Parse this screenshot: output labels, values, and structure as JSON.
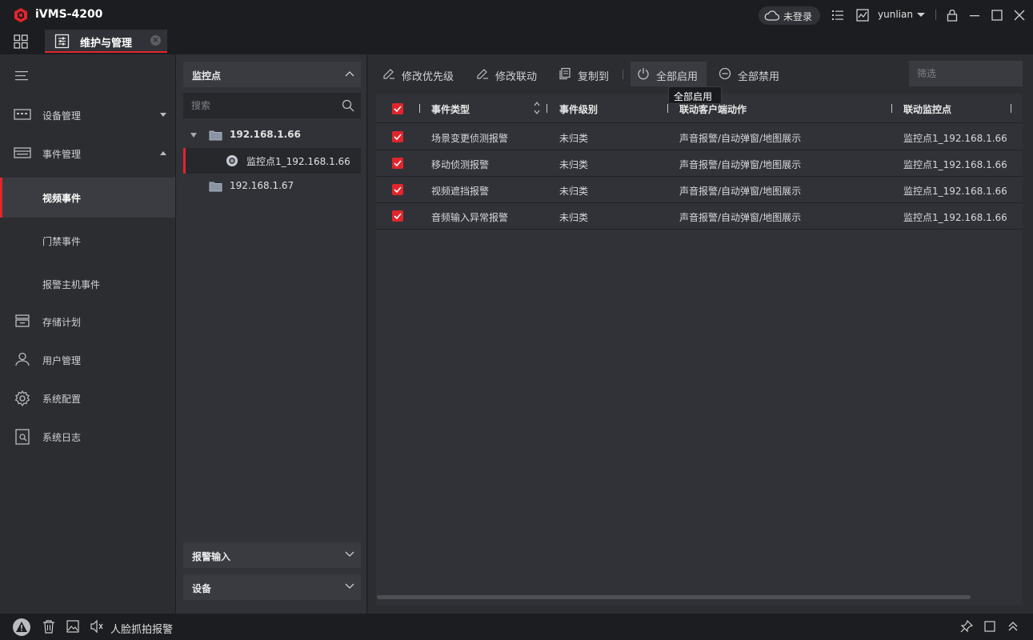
{
  "app": {
    "title": "iVMS-4200"
  },
  "titlebar": {
    "cloud_label": "未登录",
    "user": "yunlian"
  },
  "tab": {
    "label": "维护与管理"
  },
  "sidebar": {
    "items": [
      {
        "label": "设备管理"
      },
      {
        "label": "事件管理"
      },
      {
        "label": "视频事件"
      },
      {
        "label": "门禁事件"
      },
      {
        "label": "报警主机事件"
      },
      {
        "label": "存储计划"
      },
      {
        "label": "用户管理"
      },
      {
        "label": "系统配置"
      },
      {
        "label": "系统日志"
      }
    ]
  },
  "tree": {
    "header": "监控点",
    "search_placeholder": "搜索",
    "nodes": [
      {
        "label": "192.168.1.66"
      },
      {
        "label": "监控点1_192.168.1.66"
      },
      {
        "label": "192.168.1.67"
      }
    ],
    "alarm_input": "报警输入",
    "device": "设备"
  },
  "toolbar": {
    "edit_priority": "修改优先级",
    "edit_linkage": "修改联动",
    "copy_to": "复制到",
    "enable_all": "全部启用",
    "disable_all": "全部禁用",
    "filter_placeholder": "筛选",
    "tooltip": "全部启用"
  },
  "table": {
    "headers": [
      "事件类型",
      "事件级别",
      "联动客户端动作",
      "联动监控点"
    ],
    "rows": [
      {
        "type": "场景变更侦测报警",
        "level": "未归类",
        "action": "声音报警/自动弹窗/地图展示",
        "camera": "监控点1_192.168.1.66"
      },
      {
        "type": "移动侦测报警",
        "level": "未归类",
        "action": "声音报警/自动弹窗/地图展示",
        "camera": "监控点1_192.168.1.66"
      },
      {
        "type": "视频遮挡报警",
        "level": "未归类",
        "action": "声音报警/自动弹窗/地图展示",
        "camera": "监控点1_192.168.1.66"
      },
      {
        "type": "音频输入异常报警",
        "level": "未归类",
        "action": "声音报警/自动弹窗/地图展示",
        "camera": "监控点1_192.168.1.66"
      }
    ]
  },
  "statusbar": {
    "label": "人脸抓拍报警"
  },
  "colors": {
    "accent": "#e1252b",
    "background": "#2b2d31"
  }
}
